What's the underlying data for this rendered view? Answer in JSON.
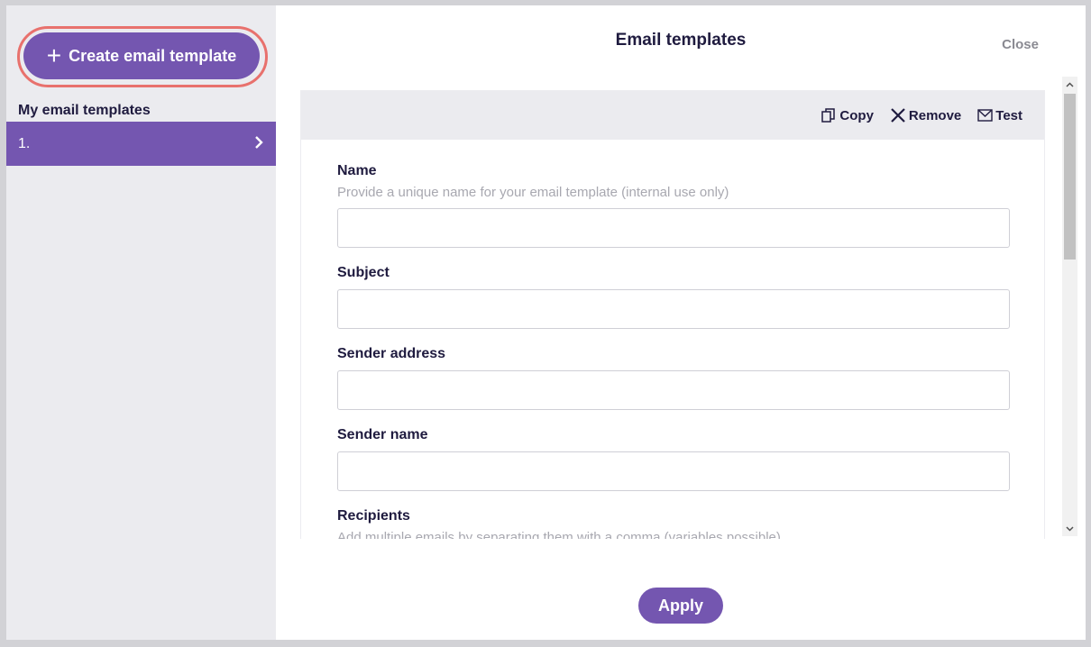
{
  "sidebar": {
    "create_button_label": "Create email template",
    "section_title": "My email templates",
    "items": [
      {
        "label": "1."
      }
    ]
  },
  "header": {
    "title": "Email templates",
    "close_label": "Close"
  },
  "toolbar": {
    "copy_label": "Copy",
    "remove_label": "Remove",
    "test_label": "Test"
  },
  "form": {
    "name": {
      "label": "Name",
      "hint": "Provide a unique name for your email template (internal use only)",
      "value": ""
    },
    "subject": {
      "label": "Subject",
      "value": ""
    },
    "sender_address": {
      "label": "Sender address",
      "value": ""
    },
    "sender_name": {
      "label": "Sender name",
      "value": ""
    },
    "recipients": {
      "label": "Recipients",
      "hint": "Add multiple emails by separating them with a comma (variables possible)",
      "value": ""
    }
  },
  "footer": {
    "apply_label": "Apply"
  },
  "colors": {
    "accent": "#7456b0",
    "highlight_ring": "#e8716d",
    "sidebar_bg": "#ebebef"
  },
  "icons": {
    "create": "plus-icon",
    "item_chevron": "chevron-right-icon",
    "copy": "copy-icon",
    "remove": "close-x-icon",
    "test": "envelope-icon"
  }
}
